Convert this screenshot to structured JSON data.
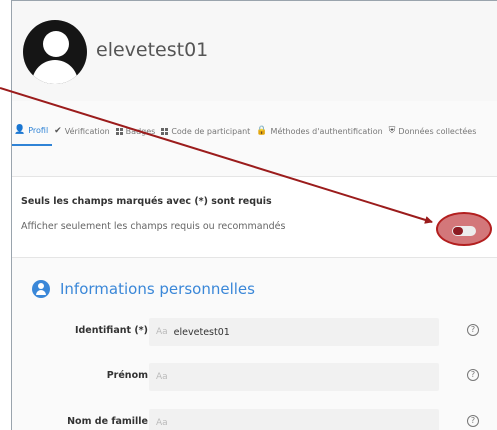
{
  "profile": {
    "username": "elevetest01"
  },
  "tabs": [
    {
      "label": "Profil",
      "icon": "user-icon",
      "active": true
    },
    {
      "label": "Vérification",
      "icon": "check-icon"
    },
    {
      "label": "Badges",
      "icon": "grid-icon"
    },
    {
      "label": "Code de participant",
      "icon": "grid-icon"
    },
    {
      "label": "Méthodes d'authentification",
      "icon": "lock-icon"
    },
    {
      "label": "Données collectées",
      "icon": "shield-icon"
    }
  ],
  "notice": {
    "title": "Seuls les champs marqués avec (*) sont requis",
    "toggle_label": "Afficher seulement les champs requis ou recommandés",
    "toggle_on": false
  },
  "section": {
    "title": "Informations personnelles",
    "fields": [
      {
        "label": "Identifiant (*)",
        "type_hint": "Aa",
        "value": "elevetest01",
        "help": "?"
      },
      {
        "label": "Prénom",
        "type_hint": "Aa",
        "value": "",
        "help": "?"
      },
      {
        "label": "Nom de famille",
        "type_hint": "Aa",
        "value": "",
        "help": "?"
      }
    ]
  },
  "colors": {
    "accent": "#3a87d8",
    "annotation": "#b31f1f"
  }
}
